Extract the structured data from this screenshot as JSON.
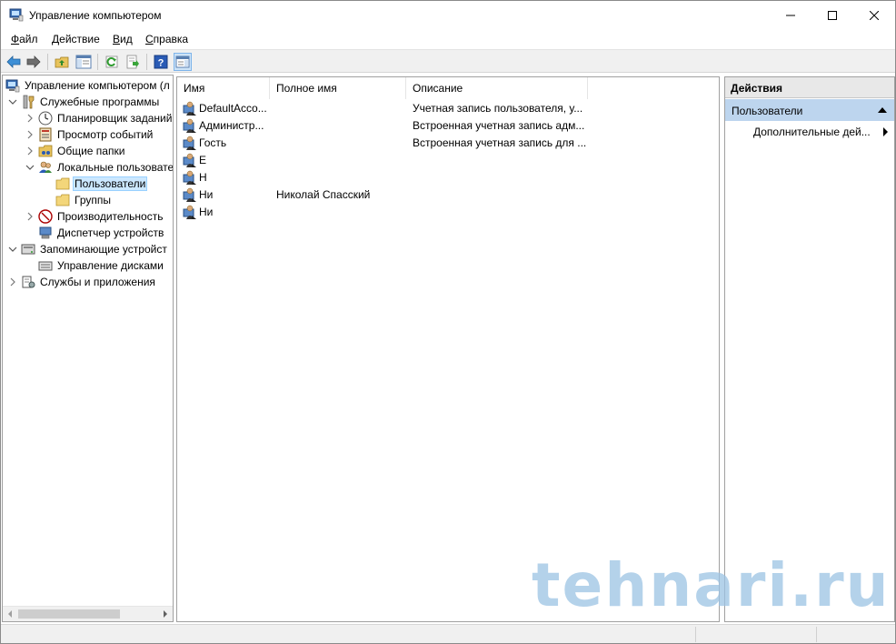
{
  "window": {
    "title": "Управление компьютером",
    "controls": {
      "minimize": "minimize-icon",
      "maximize": "maximize-icon",
      "close": "close-icon"
    }
  },
  "menu": [
    {
      "u": "Ф",
      "rest": "айл"
    },
    {
      "u": "Д",
      "rest": "ействие"
    },
    {
      "u": "В",
      "rest": "ид"
    },
    {
      "u": "С",
      "rest": "правка"
    }
  ],
  "toolbar": {
    "icons": [
      "back-icon",
      "forward-icon",
      "up-folder-icon",
      "show-hide-tree-icon",
      "refresh-icon",
      "export-list-icon",
      "help-icon",
      "show-hide-action-pane-icon"
    ]
  },
  "tree": {
    "items": [
      {
        "label": "Управление компьютером (л",
        "icon": "computer-management-icon",
        "level": 0,
        "expander": "none"
      },
      {
        "label": "Служебные программы",
        "icon": "system-tools-icon",
        "level": 1,
        "expander": "expanded"
      },
      {
        "label": "Планировщик заданий",
        "icon": "task-scheduler-icon",
        "level": 2,
        "expander": "collapsed"
      },
      {
        "label": "Просмотр событий",
        "icon": "event-viewer-icon",
        "level": 2,
        "expander": "collapsed"
      },
      {
        "label": "Общие папки",
        "icon": "shared-folders-icon",
        "level": 2,
        "expander": "collapsed"
      },
      {
        "label": "Локальные пользовате",
        "icon": "local-users-groups-icon",
        "level": 2,
        "expander": "expanded"
      },
      {
        "label": "Пользователи",
        "icon": "folder-icon",
        "level": 3,
        "expander": "none",
        "selected": true
      },
      {
        "label": "Группы",
        "icon": "folder-icon",
        "level": 3,
        "expander": "none"
      },
      {
        "label": "Производительность",
        "icon": "performance-icon",
        "level": 2,
        "expander": "collapsed"
      },
      {
        "label": "Диспетчер устройств",
        "icon": "device-manager-icon",
        "level": 2,
        "expander": "none"
      },
      {
        "label": "Запоминающие устройст",
        "icon": "storage-icon",
        "level": 1,
        "expander": "expanded"
      },
      {
        "label": "Управление дисками",
        "icon": "disk-management-icon",
        "level": 2,
        "expander": "none"
      },
      {
        "label": "Службы и приложения",
        "icon": "services-apps-icon",
        "level": 1,
        "expander": "collapsed"
      }
    ]
  },
  "list": {
    "columns": [
      "Имя",
      "Полное имя",
      "Описание"
    ],
    "rows": [
      {
        "name": "DefaultAcco...",
        "full_name": "",
        "description": "Учетная запись пользователя, у..."
      },
      {
        "name": "Администр...",
        "full_name": "",
        "description": "Встроенная учетная запись адм..."
      },
      {
        "name": "Гость",
        "full_name": "",
        "description": "Встроенная учетная запись для ..."
      },
      {
        "name": "Е",
        "full_name": "",
        "description": ""
      },
      {
        "name": "Н",
        "full_name": "",
        "description": ""
      },
      {
        "name": "Ни",
        "full_name": "Николай Спасский",
        "description": ""
      },
      {
        "name": "Ни",
        "full_name": "",
        "description": ""
      }
    ]
  },
  "actions": {
    "title": "Действия",
    "section": "Пользователи",
    "item": "Дополнительные дей..."
  },
  "watermark": "tehnari.ru",
  "colors": {
    "actions_section_bg": "#bdd5ee",
    "selection_bg": "#cce8ff",
    "watermark": "#9cc3e4"
  }
}
